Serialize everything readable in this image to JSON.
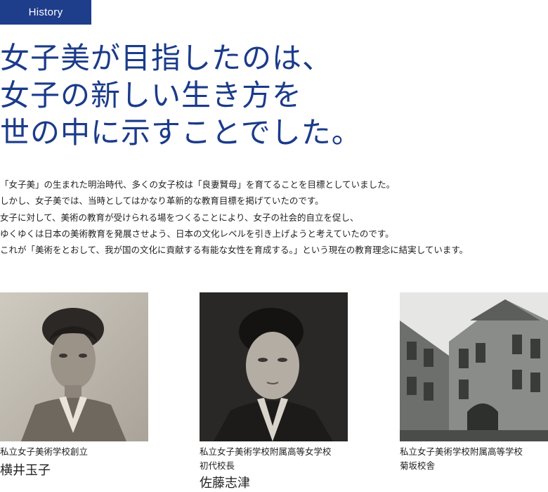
{
  "section_label": "History",
  "headline": [
    "女子美が目指したのは、",
    "女子の新しい生き方を",
    "世の中に示すことでした。"
  ],
  "body": [
    "「女子美」の生まれた明治時代、多くの女子校は「良妻賢母」を育てることを目標としていました。",
    "しかし、女子美では、当時としてはかなり革新的な教育目標を掲げていたのです。",
    "女子に対して、美術の教育が受けられる場をつくることにより、女子の社会的自立を促し、",
    "ゆくゆくは日本の美術教育を発展させよう、日本の文化レベルを引き上げようと考えていたのです。",
    "これが「美術をとおして、我が国の文化に貢献する有能な女性を育成する。」という現在の教育理念に結実しています。"
  ],
  "figures": [
    {
      "caption_lines": [
        "私立女子美術学校創立"
      ],
      "name": "横井玉子"
    },
    {
      "caption_lines": [
        "私立女子美術学校附属高等女学校",
        "初代校長"
      ],
      "name": "佐藤志津"
    },
    {
      "caption_lines": [
        "私立女子美術学校附属高等学校",
        "菊坂校舎"
      ],
      "name": ""
    }
  ],
  "colors": {
    "accent": "#1e3e8c",
    "headline": "#1b3b8a",
    "text": "#222222"
  }
}
